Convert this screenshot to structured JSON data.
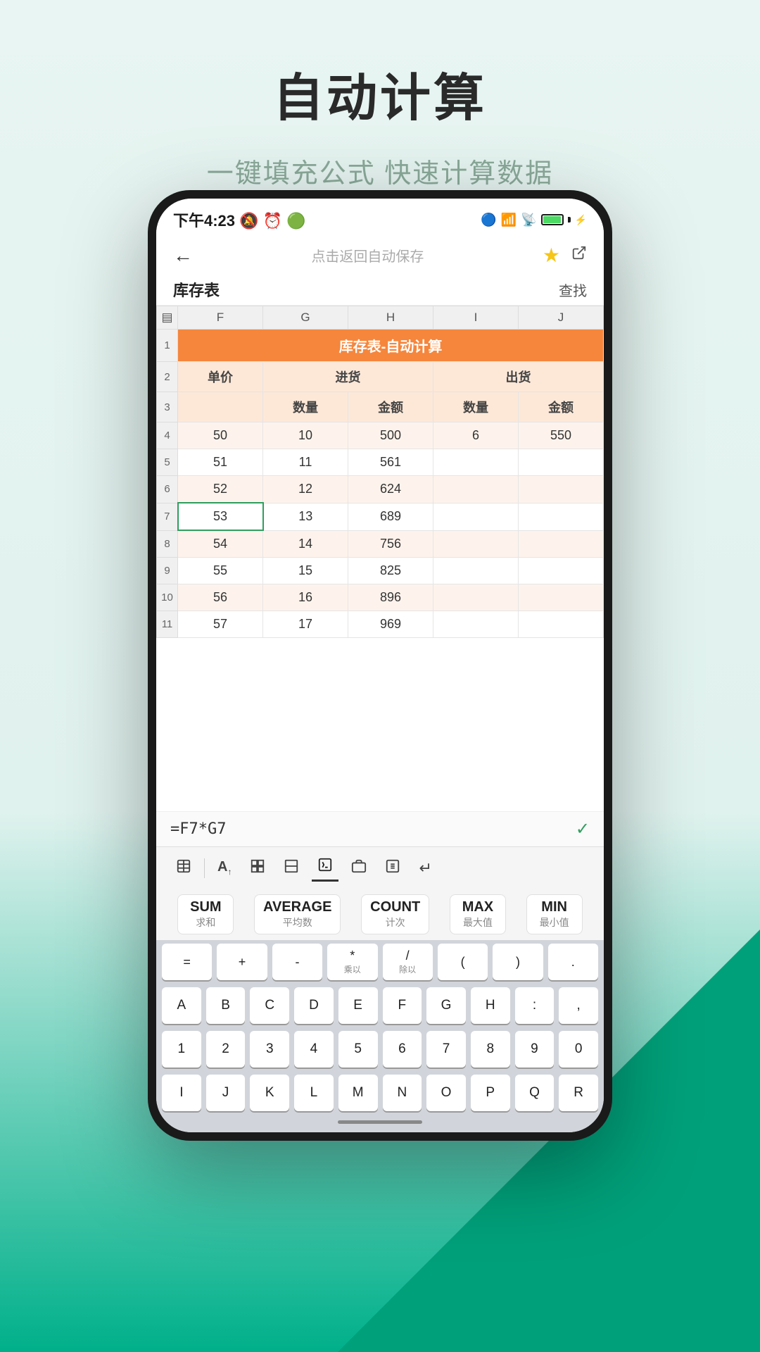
{
  "page": {
    "title": "自动计算",
    "subtitle": "一键填充公式 快速计算数据"
  },
  "status_bar": {
    "time": "下午4:23",
    "icons": "🔕 ⏰"
  },
  "nav": {
    "title": "点击返回自动保存",
    "back": "←"
  },
  "sheet": {
    "name": "库存表",
    "find": "查找",
    "spreadsheet_title": "库存表-自动计算",
    "col_headers": [
      "F",
      "G",
      "H",
      "I",
      "J"
    ],
    "row_num_header": "",
    "headers_row2": [
      "单价",
      "进货",
      "",
      "出货",
      ""
    ],
    "headers_row3": [
      "",
      "数量",
      "金额",
      "数量",
      "金额"
    ],
    "rows": [
      {
        "num": "4",
        "cells": [
          "50",
          "10",
          "500",
          "6",
          "550"
        ]
      },
      {
        "num": "5",
        "cells": [
          "51",
          "11",
          "561",
          "",
          ""
        ]
      },
      {
        "num": "6",
        "cells": [
          "52",
          "12",
          "624",
          "",
          ""
        ]
      },
      {
        "num": "7",
        "cells": [
          "53",
          "13",
          "689",
          "",
          ""
        ]
      },
      {
        "num": "8",
        "cells": [
          "54",
          "14",
          "756",
          "",
          ""
        ]
      },
      {
        "num": "9",
        "cells": [
          "55",
          "15",
          "825",
          "",
          ""
        ]
      },
      {
        "num": "10",
        "cells": [
          "56",
          "16",
          "896",
          "",
          ""
        ]
      },
      {
        "num": "11",
        "cells": [
          "57",
          "17",
          "969",
          "",
          ""
        ]
      }
    ]
  },
  "formula_bar": {
    "formula": "=F7*G7",
    "confirm": "✓"
  },
  "keyboard_toolbar": {
    "tools": [
      "▤",
      "A↑",
      "⊞",
      "⊡",
      "⊘",
      "⊞⊞",
      "⊟",
      "↵"
    ]
  },
  "function_row": {
    "buttons": [
      {
        "main": "SUM",
        "sub": "求和"
      },
      {
        "main": "AVERAGE",
        "sub": "平均数"
      },
      {
        "main": "COUNT",
        "sub": "计次"
      },
      {
        "main": "MAX",
        "sub": "最大值"
      },
      {
        "main": "MIN",
        "sub": "最小值"
      }
    ]
  },
  "operator_row": {
    "keys": [
      {
        "main": "=",
        "sub": ""
      },
      {
        "main": "+",
        "sub": ""
      },
      {
        "main": "-",
        "sub": ""
      },
      {
        "main": "*",
        "sub": "乘以"
      },
      {
        "main": "/",
        "sub": "除以"
      },
      {
        "main": "(",
        "sub": ""
      },
      {
        "main": ")",
        "sub": ""
      },
      {
        "main": ".",
        "sub": ""
      }
    ]
  },
  "keyboard_rows": {
    "row1": [
      "A",
      "B",
      "C",
      "D",
      "E",
      "F",
      "G",
      "H",
      ":",
      ","
    ],
    "row2": [
      "1",
      "2",
      "3",
      "4",
      "5",
      "6",
      "7",
      "8",
      "9",
      "0"
    ],
    "row3": [
      "I",
      "J",
      "K",
      "L",
      "M",
      "N",
      "O",
      "P",
      "Q",
      "R"
    ]
  }
}
